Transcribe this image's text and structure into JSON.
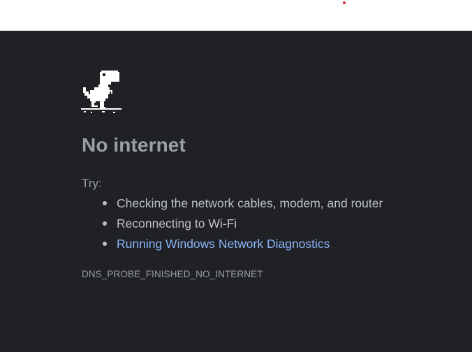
{
  "error_page": {
    "dino_icon": "offline-dinosaur-icon",
    "title": "No internet",
    "try_label": "Try:",
    "suggestions": [
      {
        "text": "Checking the network cables, modem, and router",
        "link": false
      },
      {
        "text": "Reconnecting to Wi-Fi",
        "link": false
      },
      {
        "text": "Running Windows Network Diagnostics",
        "link": true
      }
    ],
    "error_code": "DNS_PROBE_FINISHED_NO_INTERNET"
  },
  "colors": {
    "background": "#202124",
    "text": "#9aa0a6",
    "list_text": "#bdc1c6",
    "link": "#8ab4f8",
    "top_strip": "#ffffff",
    "accent_dot": "#d32f2f"
  }
}
